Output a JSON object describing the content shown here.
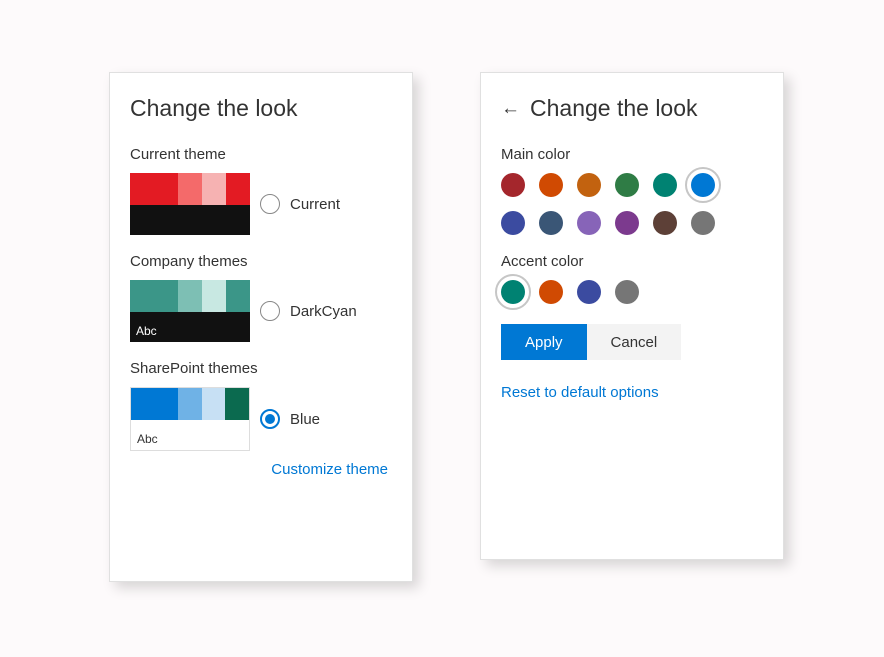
{
  "left_panel": {
    "title": "Change the look",
    "sections": {
      "current": {
        "label": "Current theme",
        "theme": {
          "top_colors": [
            "#e31b23",
            "#f46a6a",
            "#f6b2b2",
            "#e31b23"
          ],
          "bottom_color": "#111111",
          "sample_text": "",
          "name": "Current",
          "selected": false
        }
      },
      "company": {
        "label": "Company themes",
        "theme": {
          "top_colors": [
            "#3b9688",
            "#7dbfb4",
            "#c8e8e2",
            "#3b9688"
          ],
          "bottom_color": "#111111",
          "sample_text": "Abc",
          "name": "DarkCyan",
          "selected": false
        }
      },
      "sharepoint": {
        "label": "SharePoint themes",
        "theme": {
          "top_colors": [
            "#0078d4",
            "#6fb2e6",
            "#c7e0f4",
            "#0b6a4f"
          ],
          "bottom_color": "#ffffff",
          "sample_text": "Abc",
          "sample_text_color": "#333333",
          "name": "Blue",
          "selected": true
        },
        "customize_link": "Customize theme"
      }
    }
  },
  "right_panel": {
    "title": "Change the look",
    "main_color": {
      "label": "Main color",
      "options": [
        {
          "color": "#a4262c",
          "selected": false
        },
        {
          "color": "#d04a02",
          "selected": false
        },
        {
          "color": "#c2620f",
          "selected": false
        },
        {
          "color": "#2f7c45",
          "selected": false
        },
        {
          "color": "#008272",
          "selected": false
        },
        {
          "color": "#0078d4",
          "selected": true
        },
        {
          "color": "#3b4ba0",
          "selected": false
        },
        {
          "color": "#3a5676",
          "selected": false
        },
        {
          "color": "#8764b8",
          "selected": false
        },
        {
          "color": "#7c3a8e",
          "selected": false
        },
        {
          "color": "#5d4037",
          "selected": false
        },
        {
          "color": "#767676",
          "selected": false
        }
      ]
    },
    "accent_color": {
      "label": "Accent color",
      "options": [
        {
          "color": "#008272",
          "selected": true
        },
        {
          "color": "#d04a02",
          "selected": false
        },
        {
          "color": "#3b4ba0",
          "selected": false
        },
        {
          "color": "#767676",
          "selected": false
        }
      ]
    },
    "buttons": {
      "apply": "Apply",
      "cancel": "Cancel"
    },
    "reset_link": "Reset to default options"
  }
}
